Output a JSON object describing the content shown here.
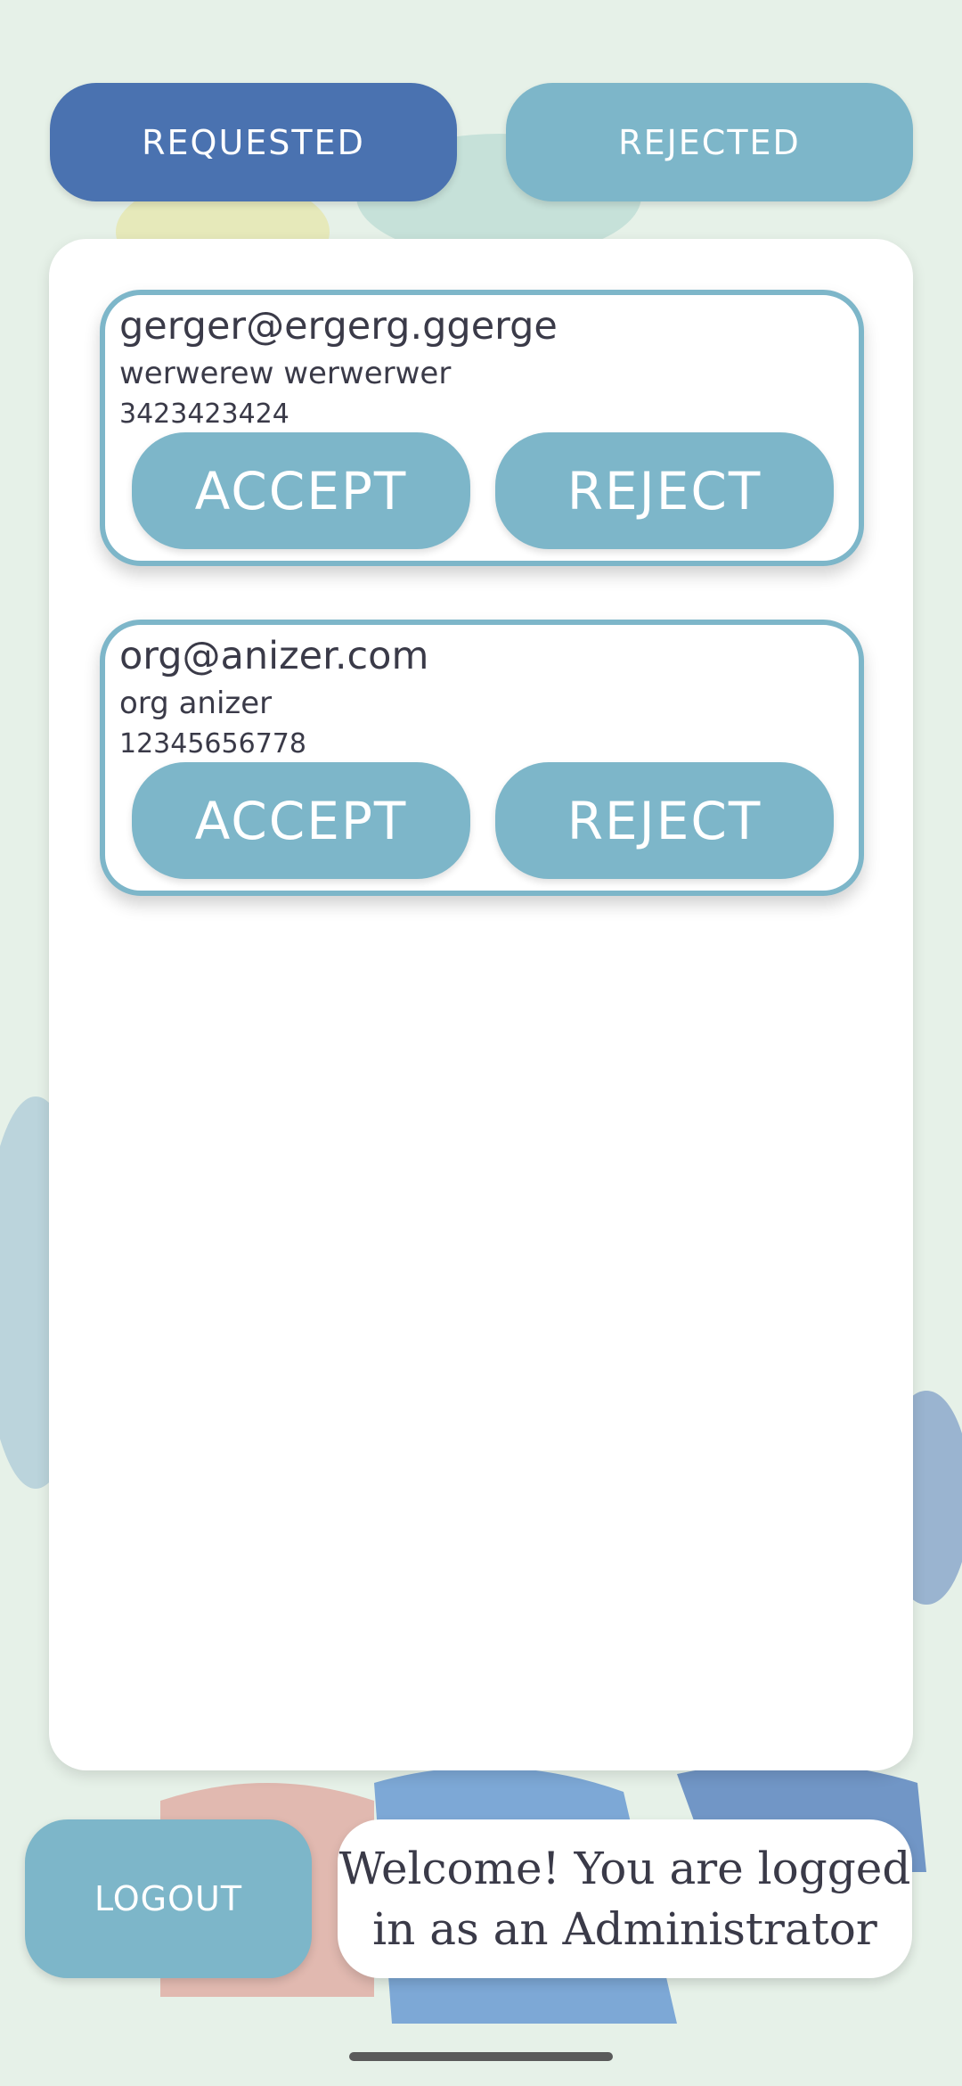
{
  "tabs": {
    "requested": "REQUESTED",
    "rejected": "REJECTED"
  },
  "requests": [
    {
      "email": "gerger@ergerg.ggerge",
      "name": "werwerew werwerwer",
      "phone": "3423423424",
      "accept": "ACCEPT",
      "reject": "REJECT"
    },
    {
      "email": "org@anizer.com",
      "name": "org anizer",
      "phone": "12345656778",
      "accept": "ACCEPT",
      "reject": "REJECT"
    }
  ],
  "footer": {
    "logout": "LOGOUT",
    "welcome_line1": "Welcome! You are logged",
    "welcome_line2": "in as an Administrator"
  },
  "colors": {
    "tab_active": "#4a72b0",
    "button": "#7db6c9",
    "card_border": "#7db6c9",
    "text": "#3a3a48"
  }
}
